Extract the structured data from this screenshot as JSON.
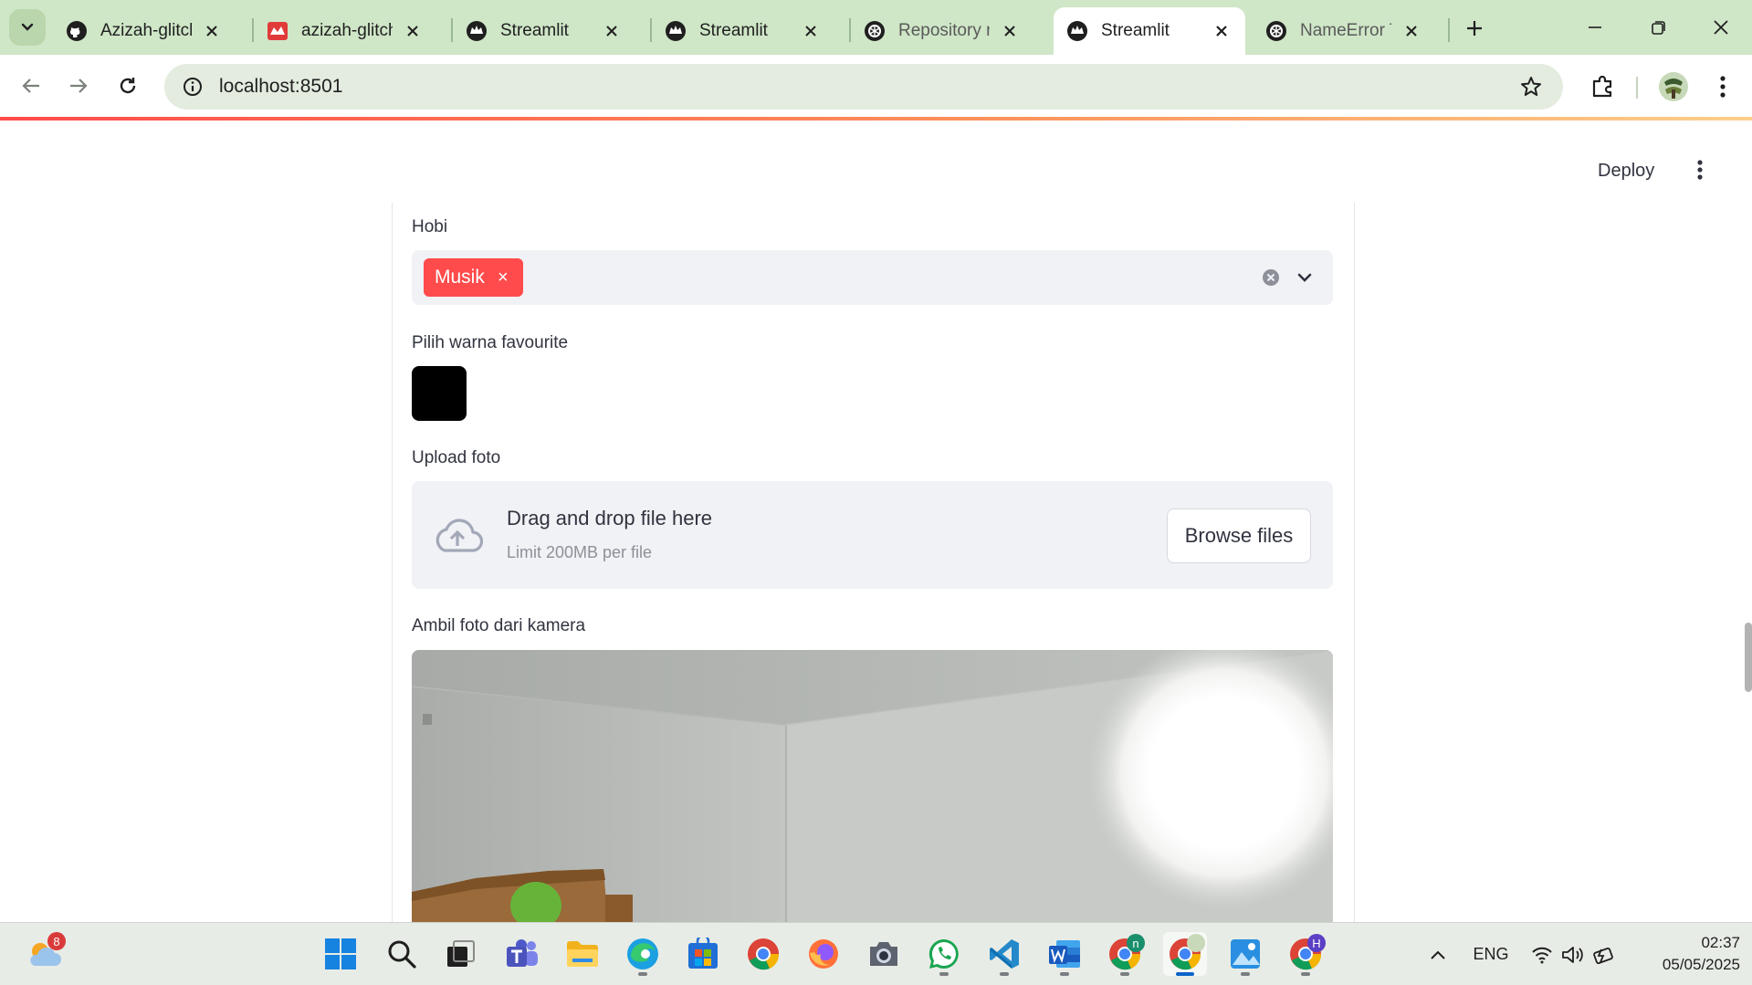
{
  "browser": {
    "tabs": [
      {
        "title": "Azizah-glitch/",
        "icon": "github-icon"
      },
      {
        "title": "azizah-glitch's",
        "icon": "streamlit-gallery-icon"
      },
      {
        "title": "Streamlit",
        "icon": "streamlit-icon"
      },
      {
        "title": "Streamlit",
        "icon": "streamlit-icon"
      },
      {
        "title": "Repository no",
        "icon": "openai-icon"
      },
      {
        "title": "Streamlit",
        "icon": "streamlit-icon",
        "active": true
      },
      {
        "title": "NameError Ta",
        "icon": "openai-icon"
      }
    ],
    "url": "localhost:8501"
  },
  "app": {
    "deploy_label": "Deploy",
    "hobi_label": "Hobi",
    "hobi_selected": [
      "Musik"
    ],
    "chip_remove": "×",
    "color_label": "Pilih warna favourite",
    "color_value": "#000000",
    "upload_label": "Upload foto",
    "upload_main": "Drag and drop file here",
    "upload_sub": "Limit 200MB per file",
    "browse_label": "Browse files",
    "camera_label": "Ambil foto dari kamera"
  },
  "taskbar": {
    "weather_badge": "8",
    "language": "ENG",
    "time": "02:37",
    "date": "05/05/2025",
    "chrome_badge_n": "n",
    "chrome_badge_h": "H"
  },
  "colors": {
    "accent": "#ff4b4b",
    "tabstrip": "#cfe6c7"
  }
}
